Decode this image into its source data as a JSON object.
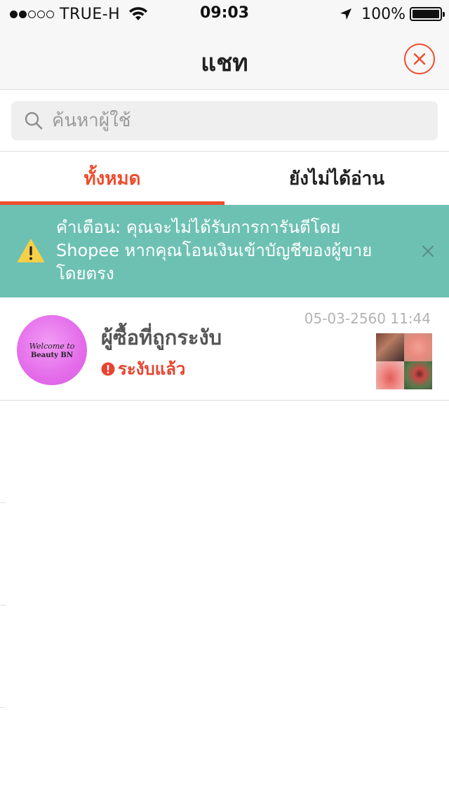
{
  "status_bar": {
    "carrier": "TRUE-H",
    "signal_bars_filled": 2,
    "signal_bars_total": 5,
    "time": "09:03",
    "battery": "100%",
    "battery_level": 1.0
  },
  "nav": {
    "title": "แชท",
    "close_icon": "close-circle-icon"
  },
  "search": {
    "placeholder": "ค้นหาผู้ใช้",
    "value": ""
  },
  "tabs": [
    {
      "label": "ทั้งหมด",
      "active": true
    },
    {
      "label": "ยังไม่ได้อ่าน",
      "active": false
    }
  ],
  "warning": {
    "text": "คำเตือน: คุณจะไม่ได้รับการการันตีโดย Shopee หากคุณโอนเงินเข้าบัญชีของผู้ขายโดยตรง",
    "icon": "warning-triangle-icon"
  },
  "chats": [
    {
      "avatar_line1": "Welcome to",
      "avatar_line2": "Beauty BN",
      "name": "ผู้ซื้อที่ถูกระงับ",
      "status": "ระงับแล้ว",
      "timestamp": "05-03-2560 11:44"
    }
  ],
  "colors": {
    "accent": "#ee4d2d",
    "warning_bg": "#6dc1b3",
    "status_red": "#e8432f"
  }
}
